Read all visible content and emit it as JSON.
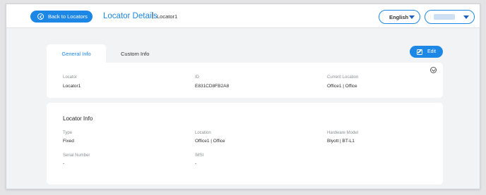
{
  "header": {
    "back_label": "Back to Locators",
    "title": "Locator Details",
    "separator": "|",
    "breadcrumb": "Locator1",
    "language": "English"
  },
  "tabs": [
    {
      "label": "General Info",
      "active": true
    },
    {
      "label": "Custom Info",
      "active": false
    }
  ],
  "actions": {
    "edit_label": "Edit"
  },
  "summary": {
    "locator_label": "Locator",
    "locator_value": "Locator1",
    "id_label": "ID",
    "id_value": "E831CD8FB2A8",
    "current_location_label": "Current Location",
    "current_location_value": "Office1 | Office"
  },
  "locator_info": {
    "title": "Locator Info",
    "type_label": "Type",
    "type_value": "Fixed",
    "location_label": "Location",
    "location_value": "Office1 | Office",
    "hardware_model_label": "Hardware Model",
    "hardware_model_value": "Blyott | BT-L1",
    "serial_number_label": "Serial Number",
    "serial_number_value": "-",
    "imsi_label": "IMSI",
    "imsi_value": "-"
  },
  "icons": {
    "back": "arrow-left-circle-icon",
    "language_dropdown": "caret-down-icon",
    "user_dropdown": "caret-down-icon",
    "edit": "edit-icon",
    "collapse": "chevron-circle-icon"
  },
  "colors": {
    "accent": "#1d87e5",
    "background": "#f2f3f5",
    "card": "#ffffff"
  }
}
